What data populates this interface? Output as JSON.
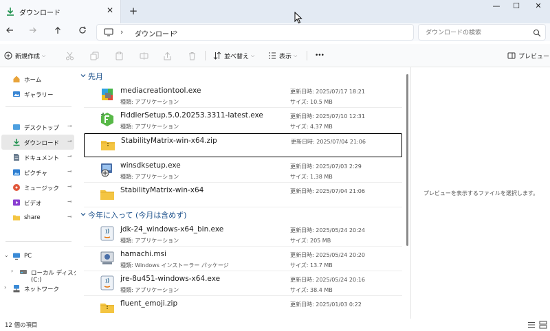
{
  "tab": {
    "title": "ダウンロード",
    "close": "✕",
    "new_tab": "+"
  },
  "window": {
    "minimize": "—",
    "maximize": "☐",
    "close": "✕"
  },
  "address": {
    "location": "ダウンロード",
    "sep": "›",
    "search_placeholder": "ダウンロードの検索",
    "search_value": ""
  },
  "commands": {
    "new": "新規作成",
    "sort": "並べ替え",
    "view": "表示",
    "more": "•••",
    "preview": "プレビュー"
  },
  "sidebar": {
    "items": [
      {
        "label": "ホーム",
        "icon": "home-icon"
      },
      {
        "label": "ギャラリー",
        "icon": "gallery-icon"
      },
      {
        "label": "デスクトップ",
        "icon": "desktop-icon",
        "pinned": true
      },
      {
        "label": "ダウンロード",
        "icon": "download-icon",
        "pinned": true,
        "active": true
      },
      {
        "label": "ドキュメント",
        "icon": "document-icon",
        "pinned": true
      },
      {
        "label": "ピクチャ",
        "icon": "pictures-icon",
        "pinned": true
      },
      {
        "label": "ミュージック",
        "icon": "music-icon",
        "pinned": true
      },
      {
        "label": "ビデオ",
        "icon": "video-icon",
        "pinned": true
      },
      {
        "label": "share",
        "icon": "folder-icon",
        "pinned": true
      },
      {
        "label": "PC",
        "icon": "pc-icon"
      },
      {
        "label": "ローカル ディスク (C:)",
        "icon": "disk-icon"
      },
      {
        "label": "ネットワーク",
        "icon": "network-icon"
      }
    ],
    "pin_glyph": "📌"
  },
  "groups": [
    {
      "label": "先月"
    },
    {
      "label": "今年に入って (今月は含めず)"
    }
  ],
  "files": [
    {
      "name": "mediacreationtool.exe",
      "type_label": "種類: アプリケーション",
      "date_label": "更新日時: 2025/07/17 18:21",
      "size_label": "サイズ: 10.5 MB",
      "icon": "installer-icon"
    },
    {
      "name": "FiddlerSetup.5.0.20253.3311-latest.exe",
      "type_label": "種類: アプリケーション",
      "date_label": "更新日時: 2025/07/10 12:31",
      "size_label": "サイズ: 4.37 MB",
      "icon": "fiddler-icon"
    },
    {
      "name": "StabilityMatrix-win-x64.zip",
      "type_label": "",
      "date_label": "更新日時: 2025/07/04 21:06",
      "size_label": "",
      "icon": "zip-folder-icon",
      "selected": true
    },
    {
      "name": "winsdksetup.exe",
      "type_label": "種類: アプリケーション",
      "date_label": "更新日時: 2025/07/03 2:29",
      "size_label": "サイズ: 1.38 MB",
      "icon": "setup-icon"
    },
    {
      "name": "StabilityMatrix-win-x64",
      "type_label": "",
      "date_label": "更新日時: 2025/07/04 21:06",
      "size_label": "",
      "icon": "folder-icon"
    },
    {
      "name": "jdk-24_windows-x64_bin.exe",
      "type_label": "種類: アプリケーション",
      "date_label": "更新日時: 2025/05/24 20:24",
      "size_label": "サイズ: 205 MB",
      "icon": "java-icon"
    },
    {
      "name": "hamachi.msi",
      "type_label": "種類: Windows インストーラー パッケージ",
      "date_label": "更新日時: 2025/05/24 20:20",
      "size_label": "サイズ: 13.7 MB",
      "icon": "msi-icon"
    },
    {
      "name": "jre-8u451-windows-x64.exe",
      "type_label": "種類: アプリケーション",
      "date_label": "更新日時: 2025/05/24 20:16",
      "size_label": "サイズ: 38.4 MB",
      "icon": "java-icon"
    },
    {
      "name": "fluent_emoji.zip",
      "type_label": "",
      "date_label": "更新日時: 2025/01/03 0:22",
      "size_label": "",
      "icon": "zip-folder-icon"
    }
  ],
  "preview": {
    "message": "プレビューを表示するファイルを選択します。"
  },
  "status": {
    "count": "12 個の項目"
  },
  "colors": {
    "accent": "#0067c0",
    "group": "#1a4f8a",
    "folder": "#f4c542"
  }
}
